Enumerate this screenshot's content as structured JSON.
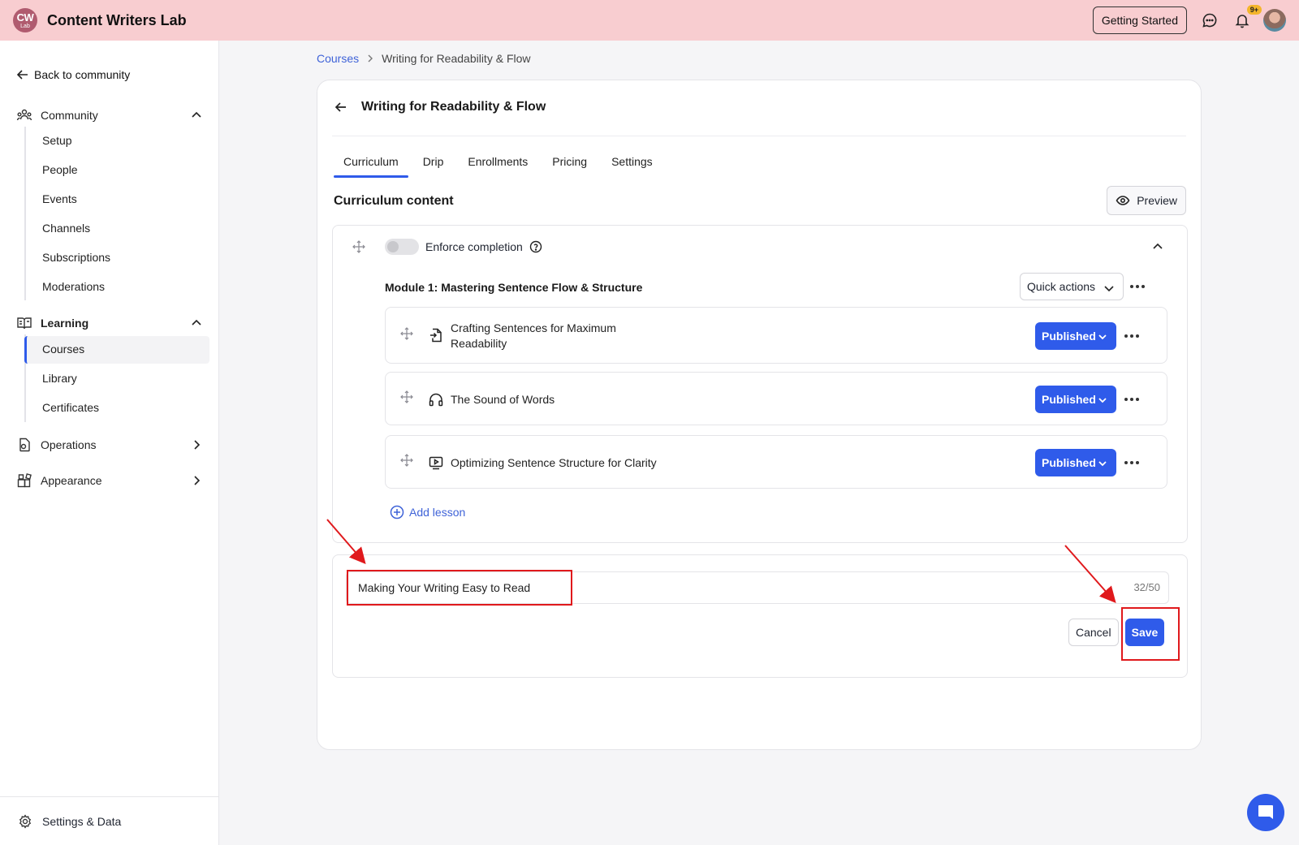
{
  "app": {
    "logo_line1": "CW",
    "logo_line2": "Lab",
    "title": "Content Writers Lab"
  },
  "topbar": {
    "getting_started": "Getting Started",
    "notification_badge": "9+"
  },
  "sidebar": {
    "back": "Back to community",
    "community": {
      "label": "Community",
      "items": [
        "Setup",
        "People",
        "Events",
        "Channels",
        "Subscriptions",
        "Moderations"
      ]
    },
    "learning": {
      "label": "Learning",
      "items": [
        "Courses",
        "Library",
        "Certificates"
      ]
    },
    "operations": "Operations",
    "appearance": "Appearance",
    "footer": "Settings & Data"
  },
  "breadcrumb": {
    "root": "Courses",
    "current": "Writing for Readability & Flow"
  },
  "course": {
    "title": "Writing for Readability & Flow"
  },
  "tabs": [
    "Curriculum",
    "Drip",
    "Enrollments",
    "Pricing",
    "Settings"
  ],
  "curriculum": {
    "title": "Curriculum content",
    "preview": "Preview",
    "enforce_completion": "Enforce completion",
    "module_title": "Module 1: Mastering Sentence Flow & Structure",
    "quick_actions": "Quick actions",
    "lessons": [
      {
        "title_line1": "Crafting Sentences for Maximum",
        "title_line2": "Readability",
        "status": "Published",
        "icon": "file-import-icon"
      },
      {
        "title": "The Sound of Words",
        "status": "Published",
        "icon": "headphones-icon"
      },
      {
        "title": "Optimizing Sentence Structure for Clarity",
        "status": "Published",
        "icon": "video-icon"
      }
    ],
    "add_lesson": "Add lesson"
  },
  "new_module": {
    "value": "Making Your Writing Easy to Read",
    "counter": "32/50",
    "cancel": "Cancel",
    "save": "Save"
  },
  "colors": {
    "accent": "#2f5bea",
    "topbar": "#f8cdd0",
    "annotation": "#e0191c"
  }
}
